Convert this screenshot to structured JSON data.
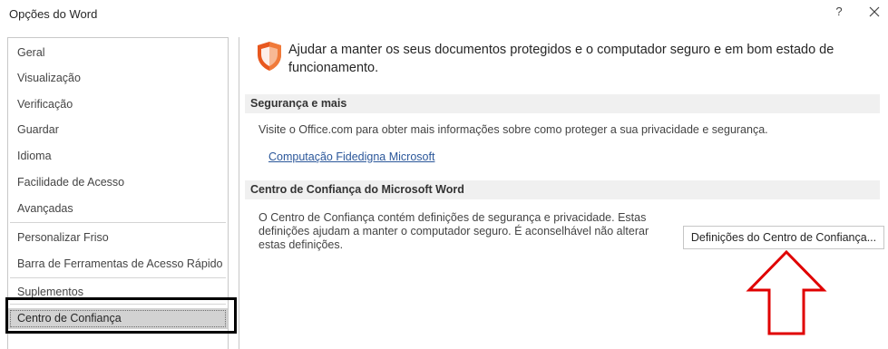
{
  "window": {
    "title": "Opções do Word",
    "help_label": "?"
  },
  "sidebar": {
    "items": [
      {
        "label": "Geral"
      },
      {
        "label": "Visualização"
      },
      {
        "label": "Verificação"
      },
      {
        "label": "Guardar"
      },
      {
        "label": "Idioma"
      },
      {
        "label": "Facilidade de Acesso"
      },
      {
        "label": "Avançadas"
      },
      {
        "label": "Personalizar Friso"
      },
      {
        "label": "Barra de Ferramentas de Acesso Rápido"
      },
      {
        "label": "Suplementos"
      },
      {
        "label": "Centro de Confiança",
        "selected": true
      }
    ]
  },
  "main": {
    "intro_icon": "shield-icon",
    "intro_text": "Ajudar a manter os seus documentos protegidos e o computador seguro e em bom estado de funcionamento.",
    "security_section": {
      "header": "Segurança e mais",
      "description": "Visite o Office.com para obter mais informações sobre como proteger a sua privacidade e segurança.",
      "link": "Computação Fidedigna Microsoft"
    },
    "trust_section": {
      "header": "Centro de Confiança do Microsoft Word",
      "description": "O Centro de Confiança contém definições de segurança e privacidade. Estas definições ajudam a manter o computador seguro. É aconselhável não alterar estas definições.",
      "button_label": "Definições do Centro de Confiança..."
    }
  },
  "annotations": {
    "highlight_color": "#000000",
    "arrow_color": "#e00000"
  },
  "colors": {
    "shield": "#e8571e",
    "link": "#2b579a",
    "selected_bg": "#d2d2d2",
    "section_bg": "#f0f0f0"
  }
}
